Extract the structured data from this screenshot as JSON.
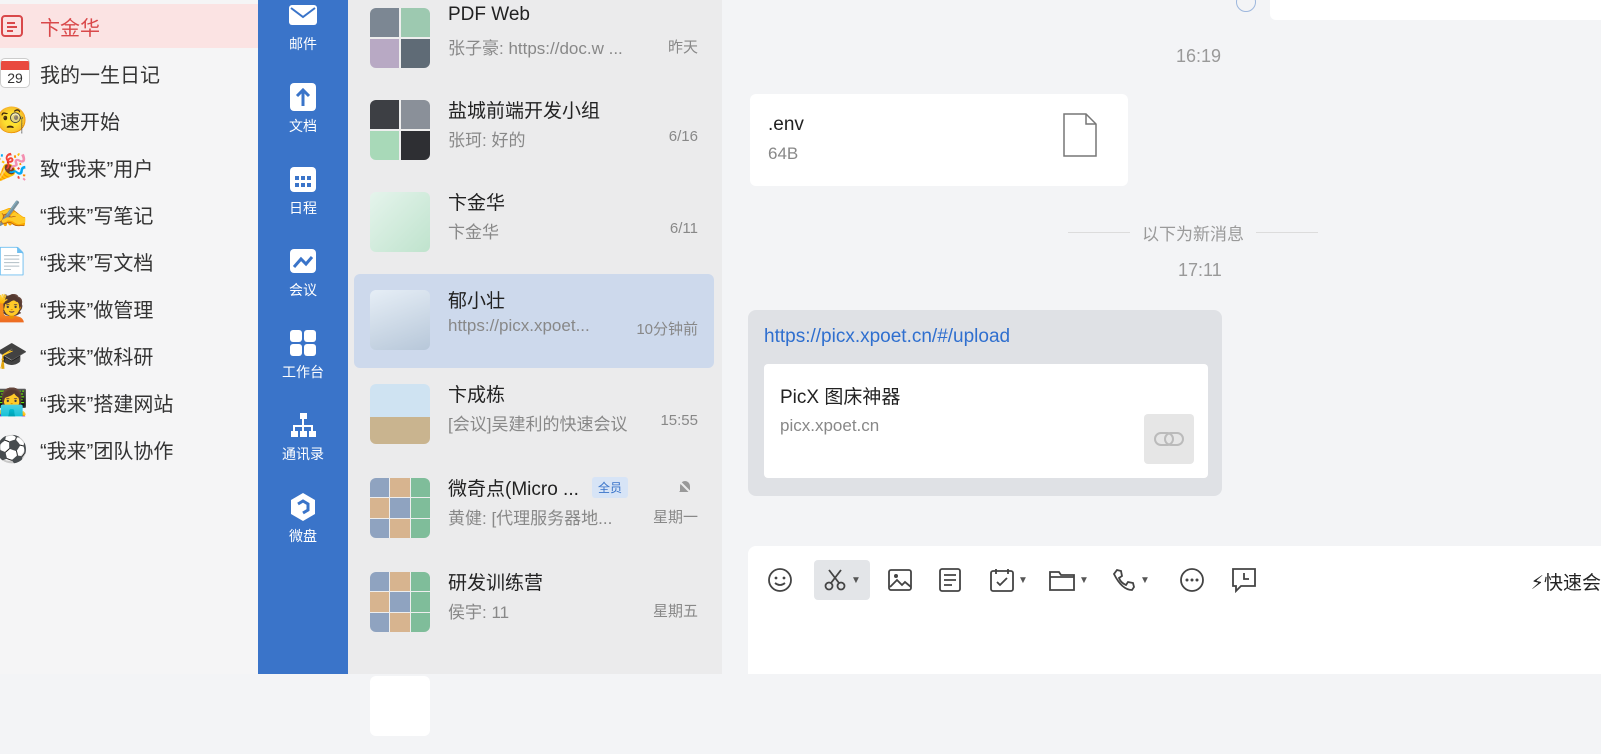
{
  "notes": {
    "items": [
      {
        "label": "卞金华",
        "icon": "document-icon"
      },
      {
        "label": "我的一生日记",
        "icon": "calendar-icon",
        "day": "29"
      },
      {
        "label": "快速开始",
        "icon": "magnifier-emoji-icon",
        "glyph": "🧐"
      },
      {
        "label": "致“我来”用户",
        "icon": "party-popper-icon",
        "glyph": "🎉"
      },
      {
        "label": "“我来”写笔记",
        "icon": "writing-hand-icon",
        "glyph": "✍️"
      },
      {
        "label": "“我来”写文档",
        "icon": "page-icon",
        "glyph": "📄"
      },
      {
        "label": "“我来”做管理",
        "icon": "person-raising-hand-icon",
        "glyph": "🙋"
      },
      {
        "label": "“我来”做科研",
        "icon": "graduation-cap-icon",
        "glyph": "🎓"
      },
      {
        "label": "“我来”搭建网站",
        "icon": "technologist-icon",
        "glyph": "👩‍💻"
      },
      {
        "label": "“我来”团队协作",
        "icon": "soccer-ball-icon",
        "glyph": "⚽"
      }
    ]
  },
  "nav": {
    "items": [
      {
        "label": "邮件",
        "icon": "mail-icon"
      },
      {
        "label": "文档",
        "icon": "document-icon"
      },
      {
        "label": "日程",
        "icon": "calendar-icon"
      },
      {
        "label": "会议",
        "icon": "meeting-icon"
      },
      {
        "label": "工作台",
        "icon": "workbench-icon"
      },
      {
        "label": "通讯录",
        "icon": "contacts-icon"
      },
      {
        "label": "微盘",
        "icon": "drive-icon"
      }
    ]
  },
  "conversations": [
    {
      "name": "PDF Web",
      "message": "张子豪: https://doc.w ...",
      "time": "昨天"
    },
    {
      "name": "盐城前端开发小组",
      "message": "张珂: 好的",
      "time": "6/16"
    },
    {
      "name": "卞金华",
      "message": "卞金华",
      "time": "6/11"
    },
    {
      "name": "郁小壮",
      "message": "https://picx.xpoet...",
      "time": "10分钟前",
      "selected": true
    },
    {
      "name": "卞成栋",
      "message": "[会议]吴建利的快速会议",
      "time": "15:55"
    },
    {
      "name": "微奇点(Micro ...",
      "tag": "全员",
      "message": "黄健: [代理服务器地...",
      "time": "星期一",
      "muted": true
    },
    {
      "name": "研发训练营",
      "message": "侯宇: 11",
      "time": "星期五"
    }
  ],
  "chat": {
    "time1": "16:19",
    "file": {
      "name": ".env",
      "size": "64B"
    },
    "new_messages_label": "以下为新消息",
    "time2": "17:11",
    "link": {
      "url": "https://picx.xpoet.cn/#/upload",
      "title": "PicX 图床神器",
      "domain": "picx.xpoet.cn"
    }
  },
  "composer": {
    "tools": [
      "emoji-icon",
      "screenshot-scissors-icon",
      "image-icon",
      "note-icon",
      "schedule-icon",
      "folder-icon",
      "phone-icon",
      "more-icon",
      "reminder-icon"
    ],
    "quick_label": "快速会"
  }
}
